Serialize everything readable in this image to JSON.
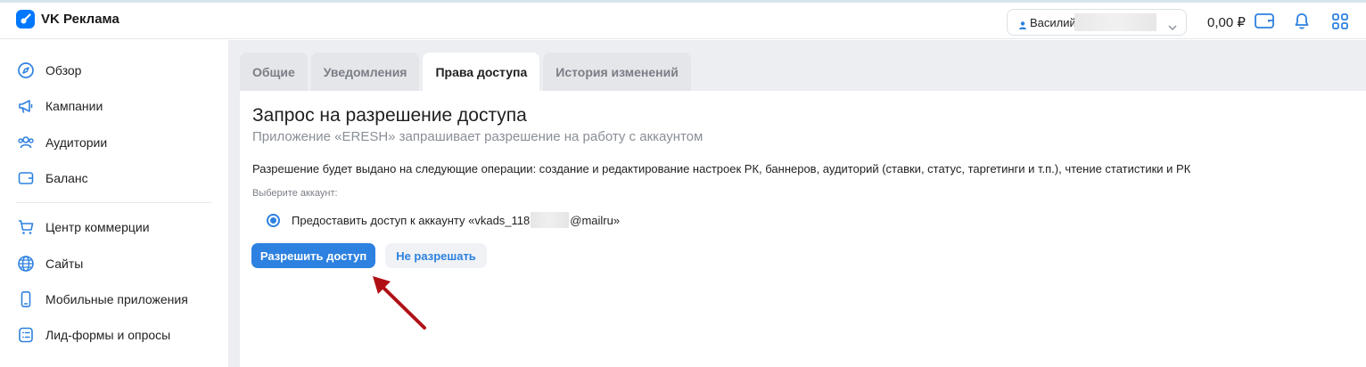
{
  "app": {
    "name": "VK Реклама"
  },
  "header": {
    "account_name": "Василий",
    "balance": "0,00 ₽"
  },
  "sidebar": {
    "items": [
      {
        "label": "Обзор",
        "icon": "compass-icon"
      },
      {
        "label": "Кампании",
        "icon": "megaphone-icon"
      },
      {
        "label": "Аудитории",
        "icon": "users-icon"
      },
      {
        "label": "Баланс",
        "icon": "wallet-icon"
      },
      {
        "label": "Центр коммерции",
        "icon": "cart-icon"
      },
      {
        "label": "Сайты",
        "icon": "globe-icon"
      },
      {
        "label": "Мобильные приложения",
        "icon": "smartphone-icon"
      },
      {
        "label": "Лид-формы и опросы",
        "icon": "list-icon"
      }
    ]
  },
  "tabs": [
    {
      "label": "Общие",
      "active": false
    },
    {
      "label": "Уведомления",
      "active": false
    },
    {
      "label": "Права доступа",
      "active": true
    },
    {
      "label": "История изменений",
      "active": false
    }
  ],
  "permission": {
    "title": "Запрос на разрешение доступа",
    "subtitle": "Приложение «ERESH» запрашивает разрешение на работу с аккаунтом",
    "description": "Разрешение будет выдано на следующие операции: создание и редактирование настроек РК, баннеров, аудиторий (ставки, статус, таргетинги и т.п.), чтение статистики и РК",
    "choose_label": "Выберите аккаунт:",
    "account_option_prefix": "Предоставить доступ к аккаунту «vkads_118",
    "account_option_suffix": "@mailru»",
    "allow_label": "Разрешить доступ",
    "deny_label": "Не разрешать"
  },
  "colors": {
    "accent": "#2d81e0",
    "annotation_arrow": "#b01015",
    "content_background": "#eceef1"
  }
}
